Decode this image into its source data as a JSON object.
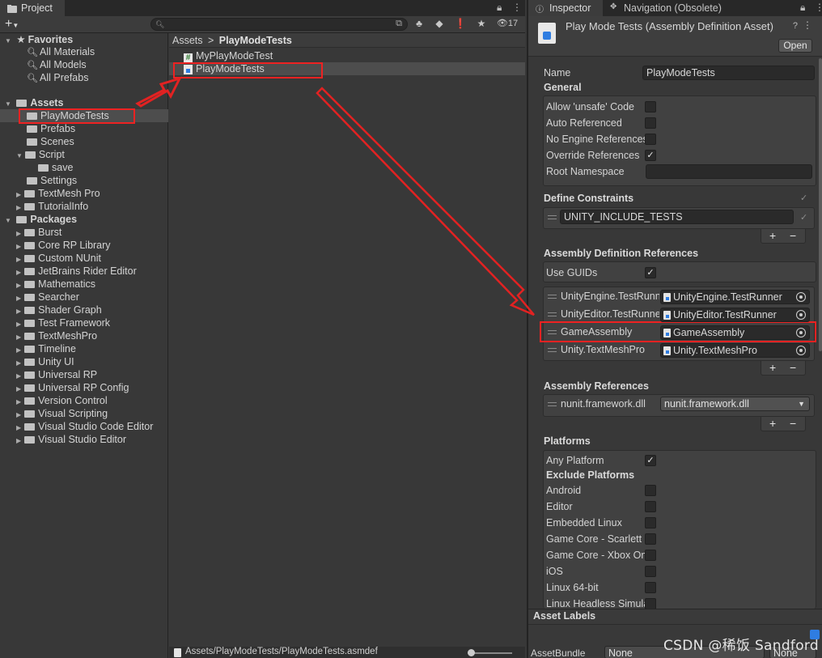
{
  "project": {
    "tab_label": "Project",
    "tab_icon": "folder-icon",
    "hidden_count": "17",
    "search": {
      "placeholder": ""
    },
    "favorites": {
      "label": "Favorites",
      "items": [
        "All Materials",
        "All Models",
        "All Prefabs"
      ]
    },
    "assets": {
      "label": "Assets",
      "items": [
        "PlayModeTests",
        "Prefabs",
        "Scenes",
        "Script",
        "save",
        "Settings",
        "TextMesh Pro",
        "TutorialInfo"
      ]
    },
    "packages": {
      "label": "Packages",
      "items": [
        "Burst",
        "Core RP Library",
        "Custom NUnit",
        "JetBrains Rider Editor",
        "Mathematics",
        "Searcher",
        "Shader Graph",
        "Test Framework",
        "TextMeshPro",
        "Timeline",
        "Unity UI",
        "Universal RP",
        "Universal RP Config",
        "Version Control",
        "Visual Scripting",
        "Visual Studio Code Editor",
        "Visual Studio Editor"
      ]
    },
    "breadcrumb": {
      "root": "Assets",
      "separator": ">",
      "current": "PlayModeTests"
    },
    "files": [
      "MyPlayModeTest",
      "PlayModeTests"
    ],
    "status_path": "Assets/PlayModeTests/PlayModeTests.asmdef"
  },
  "inspector": {
    "tab_inspector": "Inspector",
    "tab_navigation": "Navigation (Obsolete)",
    "title": "Play Mode Tests (Assembly Definition Asset)",
    "open_button": "Open",
    "name_label": "Name",
    "name_value": "PlayModeTests",
    "general_header": "General",
    "general": [
      {
        "label": "Allow 'unsafe' Code",
        "checked": false
      },
      {
        "label": "Auto Referenced",
        "checked": false
      },
      {
        "label": "No Engine References",
        "checked": false
      },
      {
        "label": "Override References",
        "checked": true
      }
    ],
    "root_namespace_label": "Root Namespace",
    "root_namespace_value": "",
    "define_header": "Define Constraints",
    "define_constraints": [
      "UNITY_INCLUDE_TESTS"
    ],
    "asmdef_refs_header": "Assembly Definition References",
    "use_guids_label": "Use GUIDs",
    "use_guids_checked": true,
    "asmdef_refs": [
      {
        "label": "UnityEngine.TestRunner",
        "value": "UnityEngine.TestRunner"
      },
      {
        "label": "UnityEditor.TestRunner",
        "value": "UnityEditor.TestRunner"
      },
      {
        "label": "GameAssembly",
        "value": "GameAssembly"
      },
      {
        "label": "Unity.TextMeshPro",
        "value": "Unity.TextMeshPro"
      }
    ],
    "assembly_refs_header": "Assembly References",
    "assembly_refs": [
      {
        "label": "nunit.framework.dll",
        "value": "nunit.framework.dll"
      }
    ],
    "platforms_header": "Platforms",
    "any_platform_label": "Any Platform",
    "any_platform_checked": true,
    "exclude_header": "Exclude Platforms",
    "exclude_platforms": [
      "Android",
      "Editor",
      "Embedded Linux",
      "Game Core - Scarlett",
      "Game Core - Xbox One",
      "iOS",
      "Linux 64-bit",
      "Linux Headless Simulation"
    ],
    "asset_labels_header": "Asset Labels",
    "assetbundle_label": "AssetBundle",
    "assetbundle_value": "None",
    "assetbundle_variant": "None"
  },
  "watermark": "CSDN @稀饭 Sandford",
  "colors": {
    "highlight_red": "#e22222",
    "selected_row": "#4d4d4d",
    "panel": "#383838"
  }
}
